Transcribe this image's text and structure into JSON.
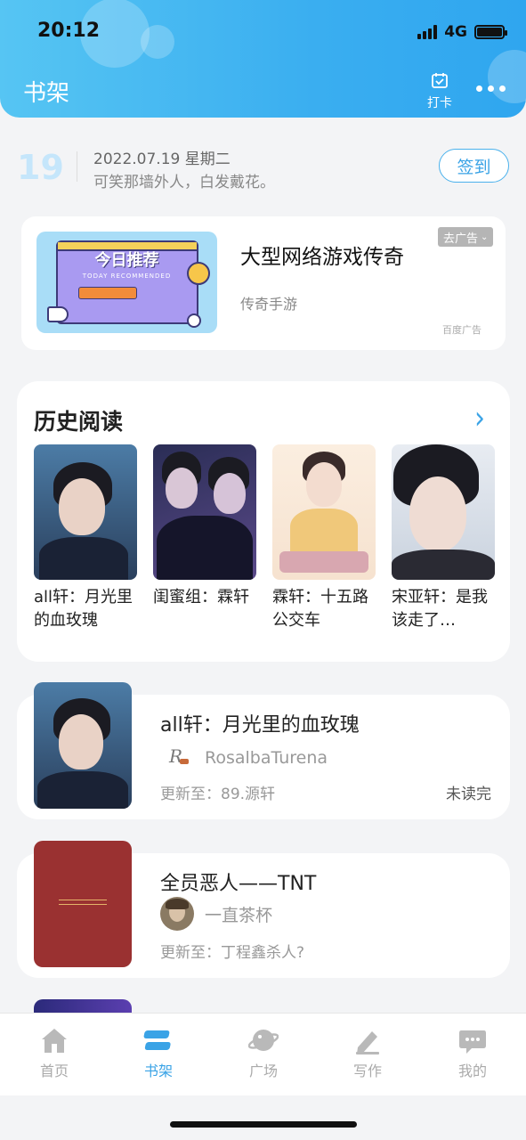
{
  "status_bar": {
    "time": "20:12",
    "network": "4G"
  },
  "header": {
    "title": "书架",
    "checkin_label": "打卡"
  },
  "daily": {
    "day": "19",
    "date": "2022.07.19 星期二",
    "quote": "可笑那墙外人，白发戴花。",
    "sign_button": "签到"
  },
  "ad": {
    "banner_text": "今日推荐",
    "banner_sub": "TODAY RECOMMENDED",
    "title": "大型网络游戏传奇",
    "subtitle": "传奇手游",
    "tag": "去广告",
    "source": "百度广告"
  },
  "history": {
    "title": "历史阅读",
    "books": [
      {
        "title": "all轩：月光里的血玫瑰"
      },
      {
        "title": "闺蜜组：霖轩"
      },
      {
        "title": "霖轩：十五路公交车"
      },
      {
        "title": "宋亚轩：是我该走了…"
      }
    ]
  },
  "shelf": [
    {
      "title": "all轩：月光里的血玫瑰",
      "author": "RosalbaTurena",
      "update": "更新至：89.源轩",
      "status": "未读完"
    },
    {
      "title": "全员恶人——TNT",
      "author": "一直茶杯",
      "update": "更新至：丁程鑫杀人?",
      "status": ""
    }
  ],
  "nav": [
    {
      "label": "首页",
      "icon": "home-icon"
    },
    {
      "label": "书架",
      "icon": "bookshelf-icon",
      "active": true
    },
    {
      "label": "广场",
      "icon": "planet-icon"
    },
    {
      "label": "写作",
      "icon": "pen-icon"
    },
    {
      "label": "我的",
      "icon": "chat-bubble-icon"
    }
  ],
  "colors": {
    "accent": "#3aa3e6",
    "header_start": "#56c5f3",
    "header_end": "#2fa6ef"
  }
}
